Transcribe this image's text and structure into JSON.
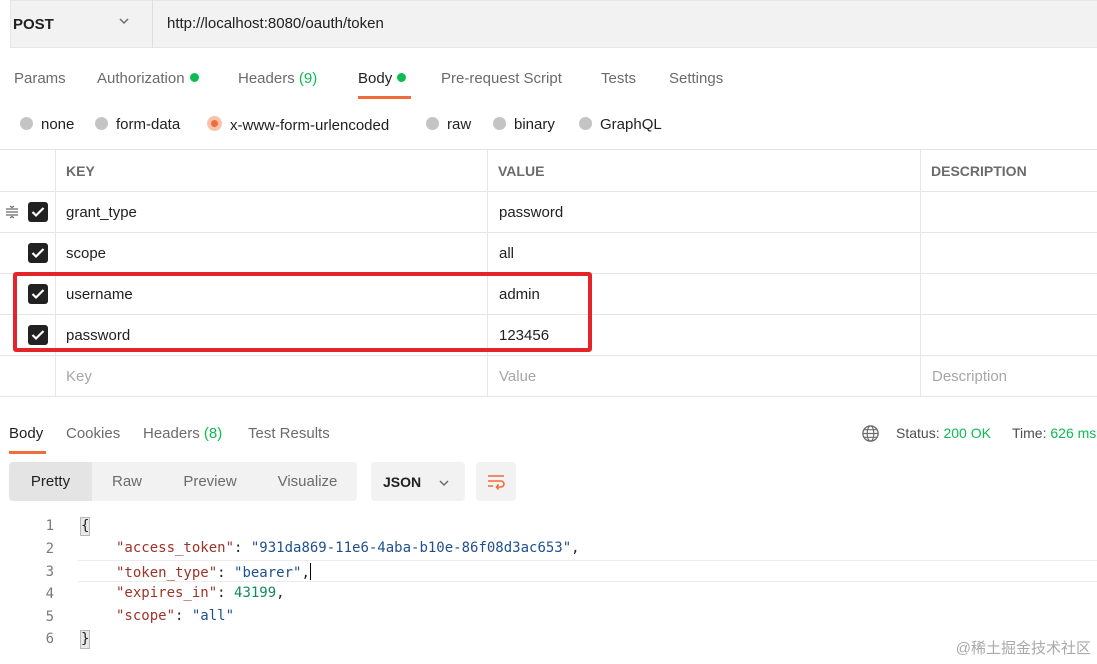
{
  "request": {
    "method": "POST",
    "url": "http://localhost:8080/oauth/token"
  },
  "request_tabs": [
    {
      "label": "Params"
    },
    {
      "label": "Authorization"
    },
    {
      "label": "Headers",
      "count": "(9)"
    },
    {
      "label": "Body"
    },
    {
      "label": "Pre-request Script"
    },
    {
      "label": "Tests"
    },
    {
      "label": "Settings"
    }
  ],
  "body_types": [
    "none",
    "form-data",
    "x-www-form-urlencoded",
    "raw",
    "binary",
    "GraphQL"
  ],
  "body_type_selected": "x-www-form-urlencoded",
  "table": {
    "headers": [
      "KEY",
      "VALUE",
      "DESCRIPTION"
    ],
    "rows": [
      {
        "key": "grant_type",
        "value": "password",
        "checked": true
      },
      {
        "key": "scope",
        "value": "all",
        "checked": true
      },
      {
        "key": "username",
        "value": "admin",
        "checked": true
      },
      {
        "key": "password",
        "value": "123456",
        "checked": true
      }
    ],
    "placeholders": {
      "key": "Key",
      "value": "Value",
      "description": "Description"
    }
  },
  "response_tabs": [
    {
      "label": "Body"
    },
    {
      "label": "Cookies"
    },
    {
      "label": "Headers",
      "count": "(8)"
    },
    {
      "label": "Test Results"
    }
  ],
  "status": {
    "status_label": "Status:",
    "status_value": "200 OK",
    "time_label": "Time:",
    "time_value": "626 ms"
  },
  "view_modes": [
    "Pretty",
    "Raw",
    "Preview",
    "Visualize"
  ],
  "format": "JSON",
  "code_lines": [
    {
      "num": "1",
      "open": "{"
    },
    {
      "num": "2",
      "key": "\"access_token\"",
      "sep": ": ",
      "str": "\"931da869-11e6-4aba-b10e-86f08d3ac653\"",
      "end": ","
    },
    {
      "num": "3",
      "key": "\"token_type\"",
      "sep": ": ",
      "str": "\"bearer\"",
      "end": ","
    },
    {
      "num": "4",
      "key": "\"expires_in\"",
      "sep": ": ",
      "num_val": "43199",
      "end": ","
    },
    {
      "num": "5",
      "key": "\"scope\"",
      "sep": ": ",
      "str": "\"all\""
    },
    {
      "num": "6",
      "close": "}"
    }
  ],
  "watermark": "@稀土掘金技术社区",
  "colors": {
    "accent": "#f26b3a",
    "success": "#0cbb52",
    "highlight": "#e3242b"
  }
}
